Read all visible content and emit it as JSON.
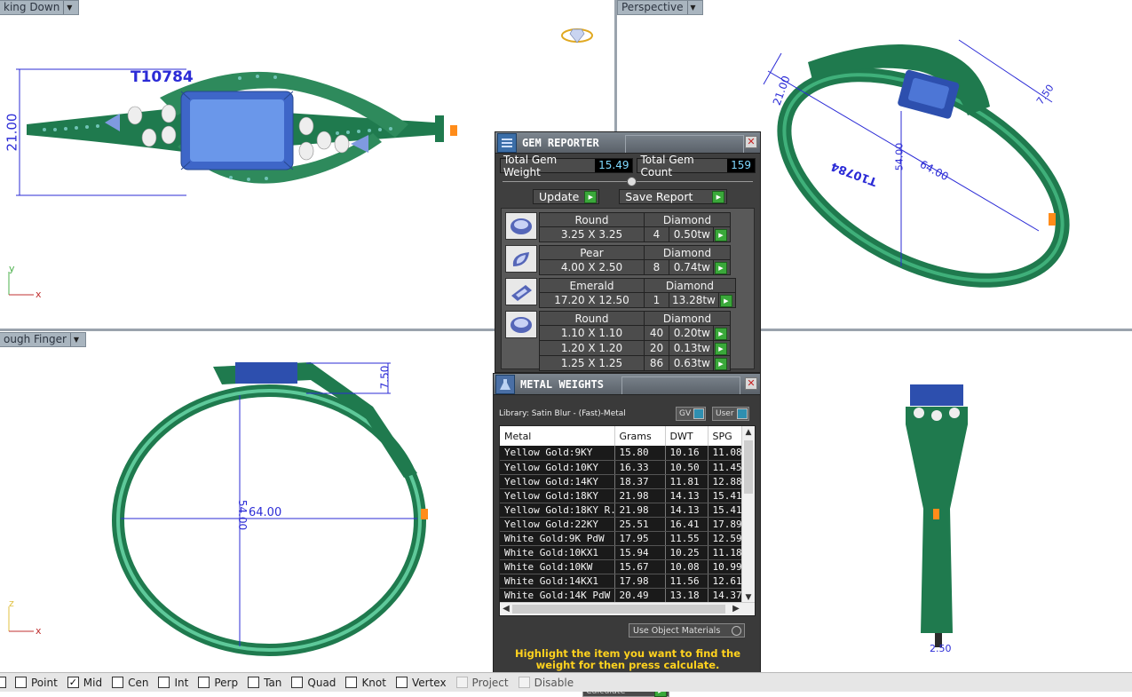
{
  "viewports": {
    "top_label": "king Down",
    "perspective_label": "Perspective",
    "front_label": "ough Finger",
    "top_model_id": "T10784",
    "top_dim_height": "21.00",
    "front_dim_width": "64.00",
    "front_dim_height": "54.00",
    "front_dim_top": "7.50",
    "right_dim_bottom": "2.50",
    "persp_dim_a": "21.00",
    "persp_dim_b": "64.00",
    "persp_dim_c": "54.00",
    "persp_dim_d": "7.50",
    "persp_model_id": "T10784",
    "axis_y": "y",
    "axis_x": "x",
    "axis_z": "z"
  },
  "gem_reporter": {
    "title": "GEM REPORTER",
    "total_weight_label": "Total Gem Weight",
    "total_weight_value": "15.49",
    "total_count_label": "Total Gem Count",
    "total_count_value": "159",
    "update_label": "Update",
    "save_report_label": "Save Report",
    "groups": [
      {
        "icon": "round-gem-icon",
        "shape": "Round",
        "material": "Diamond",
        "rows": [
          {
            "size": "3.25 X 3.25",
            "qty": "4",
            "tw": "0.50tw"
          }
        ]
      },
      {
        "icon": "pear-gem-icon",
        "shape": "Pear",
        "material": "Diamond",
        "rows": [
          {
            "size": "4.00 X 2.50",
            "qty": "8",
            "tw": "0.74tw"
          }
        ]
      },
      {
        "icon": "emerald-gem-icon",
        "shape": "Emerald",
        "material": "Diamond",
        "rows": [
          {
            "size": "17.20 X 12.50",
            "qty": "1",
            "tw": "13.28tw"
          }
        ]
      },
      {
        "icon": "round-gem-icon",
        "shape": "Round",
        "material": "Diamond",
        "rows": [
          {
            "size": "1.10 X 1.10",
            "qty": "40",
            "tw": "0.20tw"
          },
          {
            "size": "1.20 X 1.20",
            "qty": "20",
            "tw": "0.13tw"
          },
          {
            "size": "1.25 X 1.25",
            "qty": "86",
            "tw": "0.63tw"
          }
        ]
      }
    ]
  },
  "metal_weights": {
    "title": "METAL WEIGHTS",
    "library": "Library: Satin Blur - (Fast)-Metal",
    "toggle_gv": "GV",
    "toggle_user": "User",
    "columns": [
      "Metal",
      "Grams",
      "DWT",
      "SPG"
    ],
    "rows": [
      [
        "Yellow Gold:9KY",
        "15.80",
        "10.16",
        "11.08"
      ],
      [
        "Yellow Gold:10KY",
        "16.33",
        "10.50",
        "11.45"
      ],
      [
        "Yellow Gold:14KY",
        "18.37",
        "11.81",
        "12.88"
      ],
      [
        "Yellow Gold:18KY",
        "21.98",
        "14.13",
        "15.41"
      ],
      [
        "Yellow Gold:18KY R...",
        "21.98",
        "14.13",
        "15.41"
      ],
      [
        "Yellow Gold:22KY",
        "25.51",
        "16.41",
        "17.89"
      ],
      [
        "White Gold:9K PdW",
        "17.95",
        "11.55",
        "12.59"
      ],
      [
        "White Gold:10KX1",
        "15.94",
        "10.25",
        "11.18"
      ],
      [
        "White Gold:10KW",
        "15.67",
        "10.08",
        "10.99"
      ],
      [
        "White Gold:14KX1",
        "17.98",
        "11.56",
        "12.61"
      ],
      [
        "White Gold:14K PdW",
        "20.49",
        "13.18",
        "14.37"
      ]
    ],
    "use_object_materials": "Use Object Materials",
    "hint": "Highlight the item you want to find the weight for then press calculate.",
    "calculate_label": "Calculate"
  },
  "statusbar": {
    "snaps": [
      {
        "label": "Point",
        "checked": false,
        "enabled": true
      },
      {
        "label": "Mid",
        "checked": true,
        "enabled": true
      },
      {
        "label": "Cen",
        "checked": false,
        "enabled": true
      },
      {
        "label": "Int",
        "checked": false,
        "enabled": true
      },
      {
        "label": "Perp",
        "checked": false,
        "enabled": true
      },
      {
        "label": "Tan",
        "checked": false,
        "enabled": true
      },
      {
        "label": "Quad",
        "checked": false,
        "enabled": true
      },
      {
        "label": "Knot",
        "checked": false,
        "enabled": true
      },
      {
        "label": "Vertex",
        "checked": false,
        "enabled": true
      },
      {
        "label": "Project",
        "checked": false,
        "enabled": false
      },
      {
        "label": "Disable",
        "checked": false,
        "enabled": false
      }
    ]
  },
  "colors": {
    "metal_green": "#1f7a4e",
    "gem_blue": "#5b8de0",
    "dimension_blue": "#2b2bd6",
    "accent_yellow": "#ffd21e"
  }
}
